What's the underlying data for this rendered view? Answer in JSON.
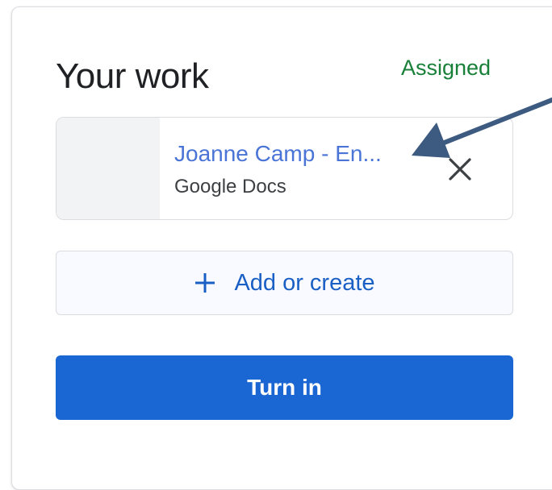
{
  "your_work": {
    "title": "Your work",
    "status": "Assigned"
  },
  "attachment": {
    "title": "Joanne Camp - En...",
    "type": "Google Docs",
    "remove_icon": "close-icon"
  },
  "add_or_create": {
    "label": "Add or create",
    "icon": "plus-icon"
  },
  "turn_in": {
    "label": "Turn in"
  },
  "annotation": {
    "icon": "arrow-annotation",
    "color": "#3d5a80"
  },
  "colors": {
    "status": "#188038",
    "link": "#4a74d6",
    "primary": "#1a66d2",
    "add_text": "#1a5fc4"
  }
}
